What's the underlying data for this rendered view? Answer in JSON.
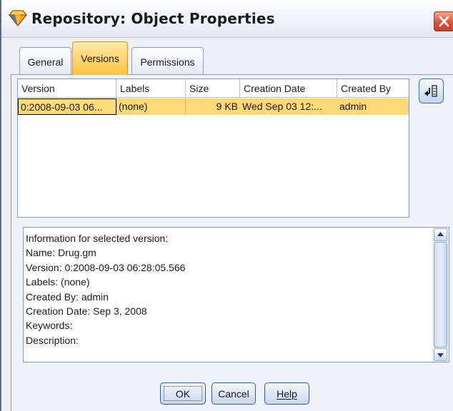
{
  "window": {
    "title": "Repository: Object Properties",
    "app_icon": "diamond-icon",
    "close_icon": "close-icon"
  },
  "tabs": [
    {
      "label": "General",
      "selected": false
    },
    {
      "label": "Versions",
      "selected": true
    },
    {
      "label": "Permissions",
      "selected": false
    }
  ],
  "table": {
    "columns": [
      "Version",
      "Labels",
      "Size",
      "Creation Date",
      "Created By"
    ],
    "rows": [
      {
        "version": "0:2008-09-03 06...",
        "labels": "(none)",
        "size": "9 KB",
        "creation_date": "Wed Sep 03 12:...",
        "created_by": "admin",
        "selected": true
      }
    ]
  },
  "side_button": {
    "icon": "column-chooser-icon"
  },
  "info": {
    "lines": [
      "Information for selected version:",
      "Name: Drug.gm",
      "Version: 0:2008-09-03 06:28:05.566",
      "Labels: (none)",
      "Created By: admin",
      "Creation Date: Sep 3, 2008",
      "Keywords:",
      "Description:"
    ]
  },
  "buttons": {
    "ok": "OK",
    "cancel": "Cancel",
    "help": "Help"
  },
  "colors": {
    "selected_tab": "#ffc240",
    "selected_row": "#fed978",
    "close_button": "#d8553c"
  }
}
